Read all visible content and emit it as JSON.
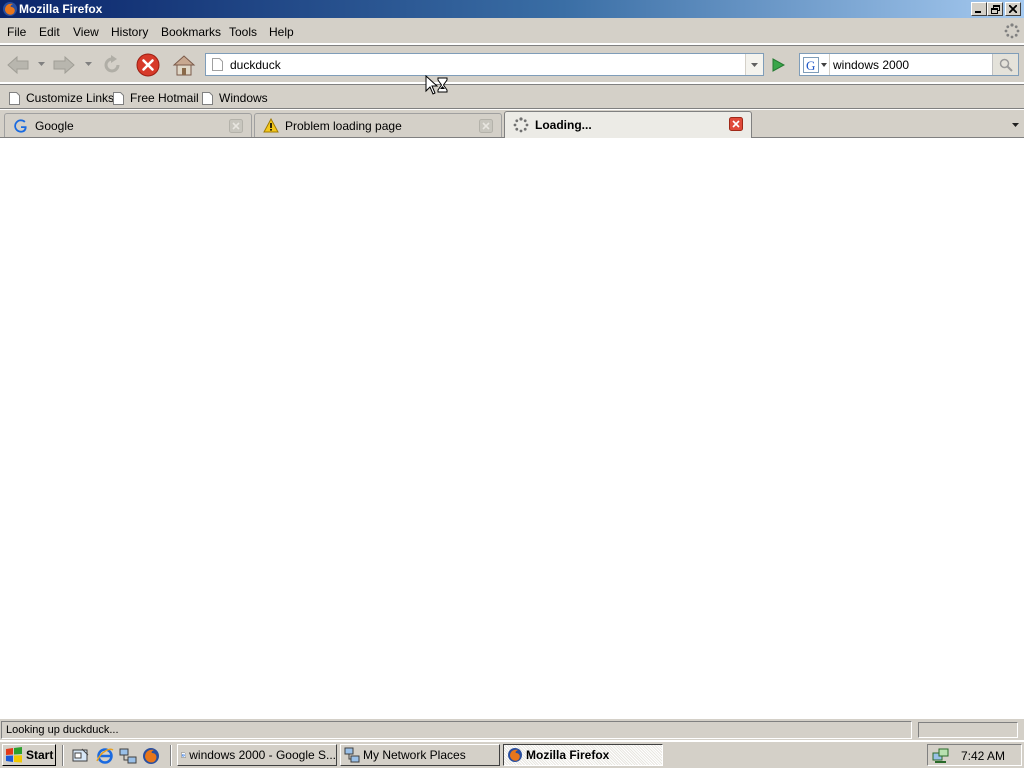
{
  "window": {
    "title": "Mozilla Firefox"
  },
  "menu": {
    "items": [
      "File",
      "Edit",
      "View",
      "History",
      "Bookmarks",
      "Tools",
      "Help"
    ]
  },
  "nav": {
    "url": "duckduck",
    "search_value": "windows 2000",
    "search_engine": "google-icon"
  },
  "bookmarks": {
    "items": [
      "Customize Links",
      "Free Hotmail",
      "Windows"
    ]
  },
  "tabs": [
    {
      "label": "Google",
      "icon": "google-icon",
      "selected": false
    },
    {
      "label": "Problem loading page",
      "icon": "warning-icon",
      "selected": false
    },
    {
      "label": "Loading...",
      "icon": "loading-spinner-icon",
      "selected": true
    }
  ],
  "status": {
    "text": "Looking up duckduck..."
  },
  "taskbar": {
    "start_label": "Start",
    "tasks": [
      {
        "label": "windows 2000 - Google S...",
        "icon": "ie-page-icon",
        "active": false
      },
      {
        "label": "My Network Places",
        "icon": "network-icon",
        "active": false
      },
      {
        "label": "Mozilla Firefox",
        "icon": "firefox-icon",
        "active": true
      }
    ],
    "clock": "7:42 AM"
  },
  "colors": {
    "titlebar_start": "#0a246a",
    "titlebar_end": "#a6caf0",
    "chrome": "#d4d0c8",
    "stop_red": "#d73a2a",
    "go_green": "#3aa64a"
  }
}
